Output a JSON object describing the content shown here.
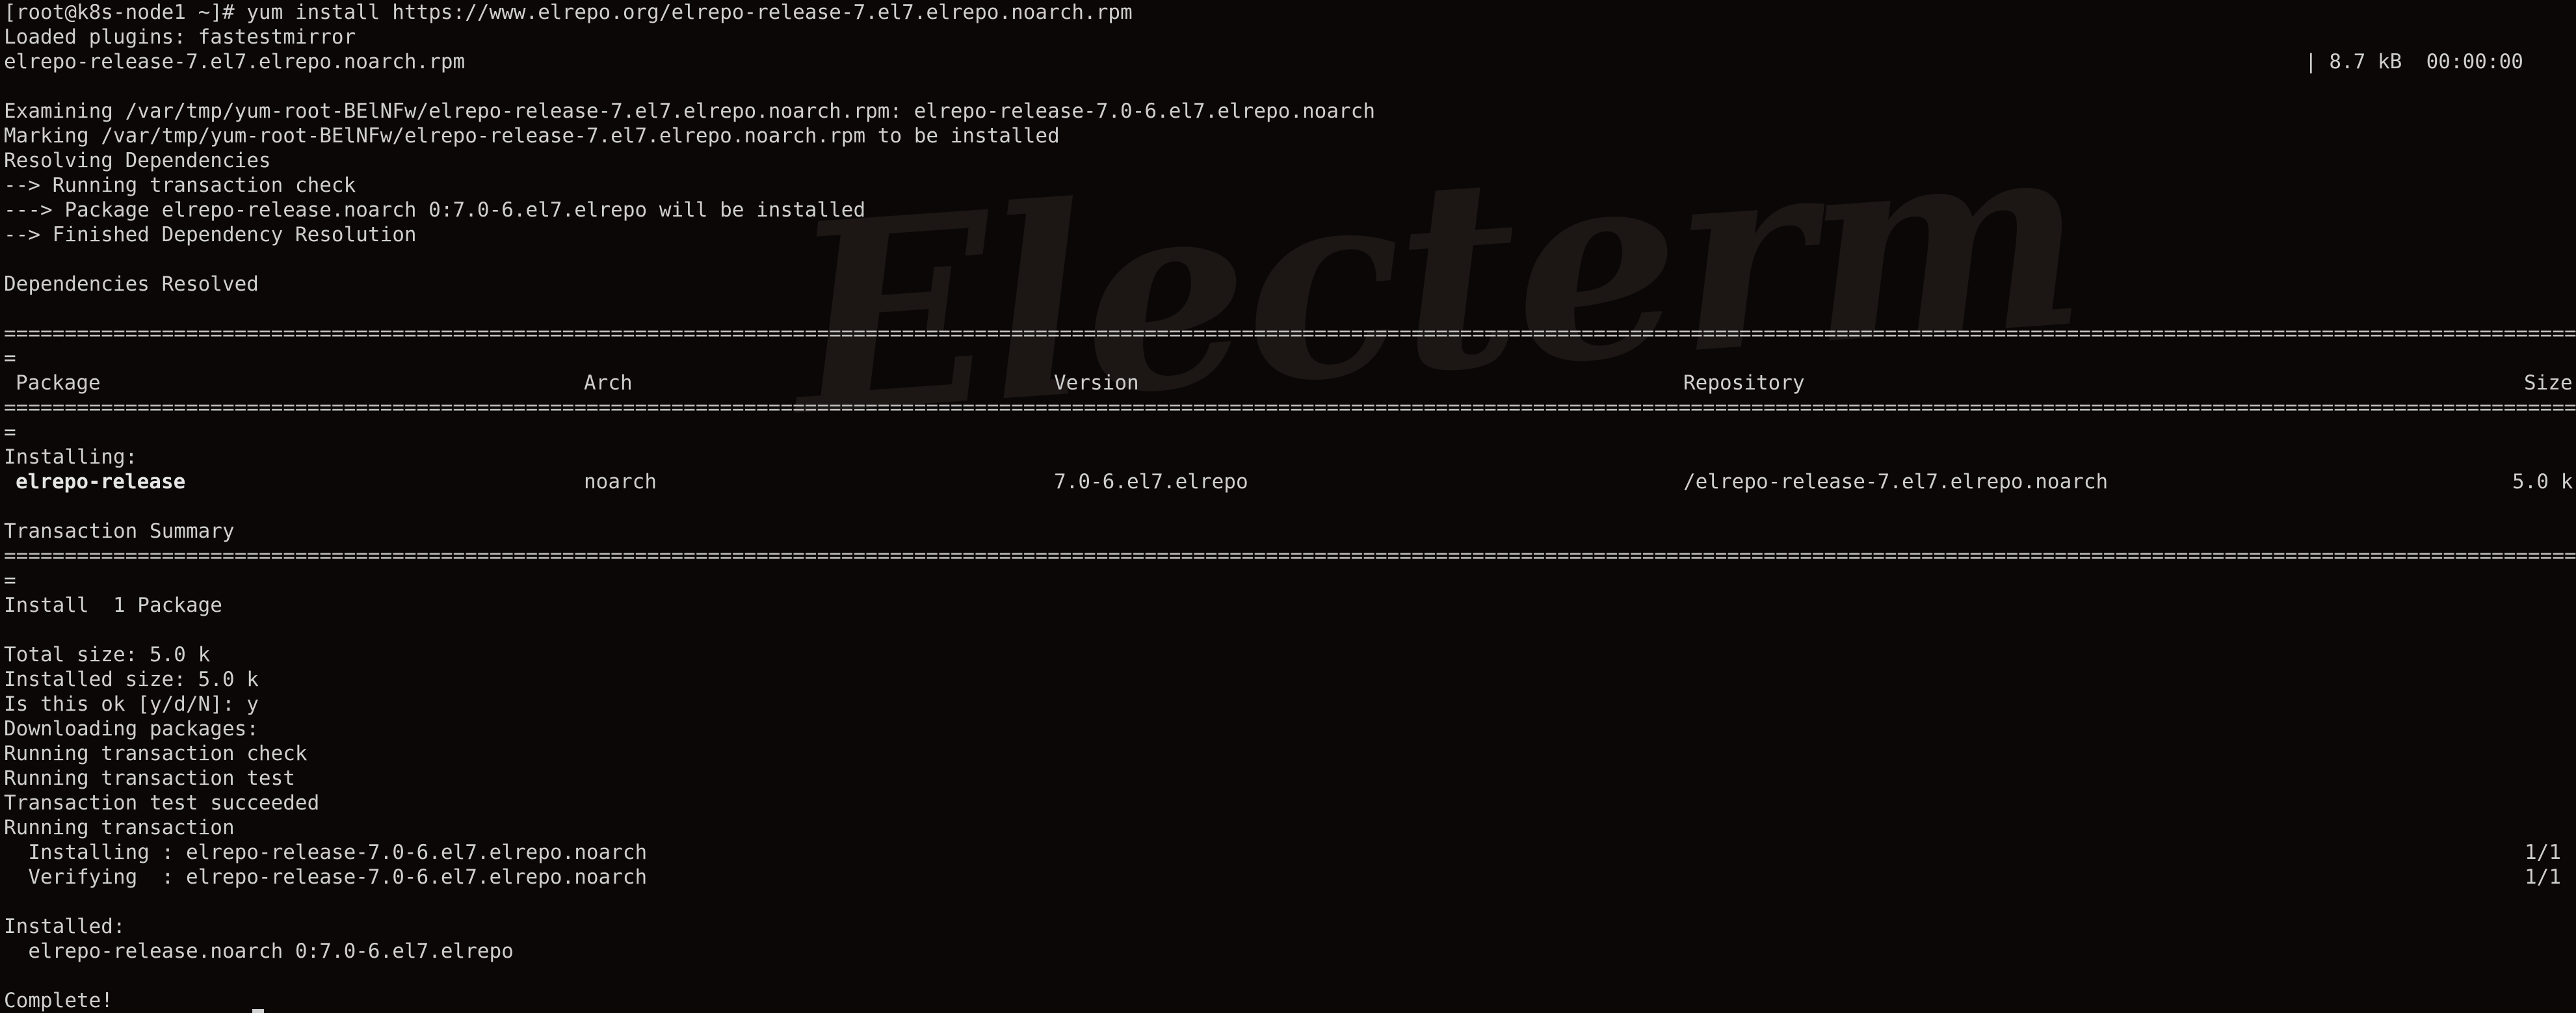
{
  "watermark": "Electerm",
  "lines": {
    "l00": "[root@k8s-node1 ~]# yum install https://www.elrepo.org/elrepo-release-7.el7.elrepo.noarch.rpm",
    "l01": "Loaded plugins: fastestmirror",
    "l02": "elrepo-release-7.el7.elrepo.noarch.rpm",
    "l02r": "| 8.7 kB  00:00:00",
    "l04": "Examining /var/tmp/yum-root-BElNFw/elrepo-release-7.el7.elrepo.noarch.rpm: elrepo-release-7.0-6.el7.elrepo.noarch",
    "l05": "Marking /var/tmp/yum-root-BElNFw/elrepo-release-7.el7.elrepo.noarch.rpm to be installed",
    "l06": "Resolving Dependencies",
    "l07": "--> Running transaction check",
    "l08": "---> Package elrepo-release.noarch 0:7.0-6.el7.elrepo will be installed",
    "l09": "--> Finished Dependency Resolution",
    "l11": "Dependencies Resolved",
    "l13": "=",
    "l16": "=",
    "l17": "Installing:",
    "l19": "Transaction Summary",
    "l21": "=",
    "l22": "Install  1 Package",
    "l24": "Total size: 5.0 k",
    "l25": "Installed size: 5.0 k",
    "l26": "Is this ok [y/d/N]: y",
    "l27": "Downloading packages:",
    "l28": "Running transaction check",
    "l29": "Running transaction test",
    "l30": "Transaction test succeeded",
    "l31": "Running transaction",
    "l32": "  Installing : elrepo-release-7.0-6.el7.elrepo.noarch",
    "l32r": "1/1",
    "l33": "  Verifying  : elrepo-release-7.0-6.el7.elrepo.noarch",
    "l33r": "1/1",
    "l35": "Installed:",
    "l36": "  elrepo-release.noarch 0:7.0-6.el7.elrepo",
    "l38": "Complete!"
  },
  "table": {
    "headers": {
      "package": "Package",
      "arch": "Arch",
      "version": "Version",
      "repository": "Repository",
      "size": "Size"
    },
    "row": {
      "package": "elrepo-release",
      "arch": "noarch",
      "version": "7.0-6.el7.elrepo",
      "repository": "/elrepo-release-7.el7.elrepo.noarch",
      "size": "5.0 k"
    }
  },
  "rule_char": "========================================================================================================================================================================================================================================"
}
